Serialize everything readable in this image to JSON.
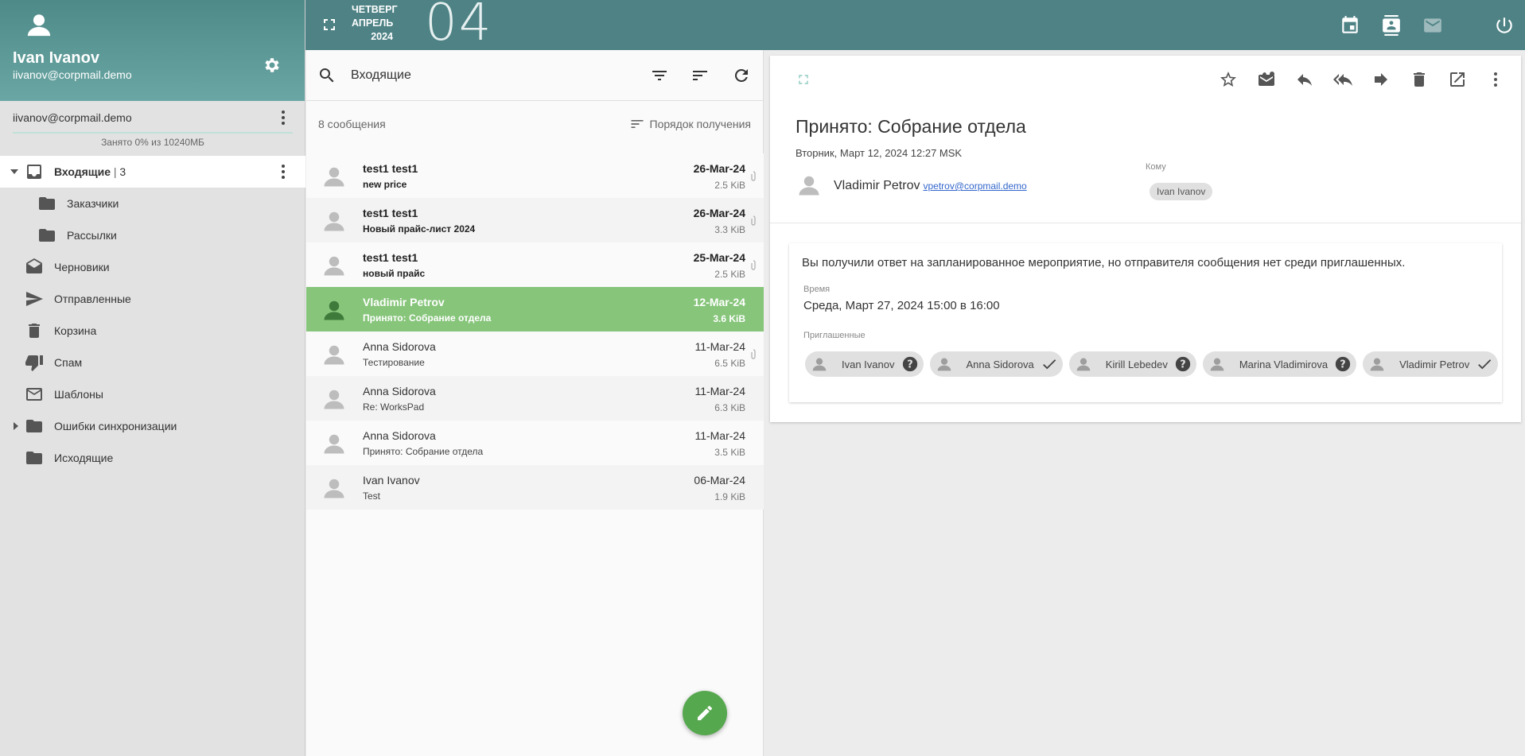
{
  "profile": {
    "name": "Ivan Ivanov",
    "email": "iivanov@corpmail.demo"
  },
  "account": {
    "address": "iivanov@corpmail.demo",
    "quota_text": "Занято 0% из 10240МБ",
    "quota_percent": 0
  },
  "folders": [
    {
      "label": "Входящие",
      "count": "3",
      "icon": "inbox-icon"
    },
    {
      "label": "Заказчики",
      "icon": "folder-icon"
    },
    {
      "label": "Рассылки",
      "icon": "folder-icon"
    },
    {
      "label": "Черновики",
      "icon": "drafts-icon"
    },
    {
      "label": "Отправленные",
      "icon": "send-icon"
    },
    {
      "label": "Корзина",
      "icon": "trash-icon"
    },
    {
      "label": "Спам",
      "icon": "thumb-down-icon"
    },
    {
      "label": "Шаблоны",
      "icon": "envelope-icon"
    },
    {
      "label": "Ошибки синхронизации",
      "icon": "folder-icon"
    },
    {
      "label": "Исходящие",
      "icon": "folder-icon"
    }
  ],
  "header": {
    "weekday": "ЧЕТВЕРГ",
    "month": "АПРЕЛЬ",
    "year": "2024",
    "day": "04"
  },
  "search": {
    "value": "Входящие"
  },
  "list": {
    "count_label": "8 сообщения",
    "sort_label": "Порядок получения"
  },
  "messages": [
    {
      "sender": "test1 test1",
      "subject": "new price",
      "date": "26-Mar-24",
      "size": "2.5 KiB",
      "attachment": true,
      "unread": true
    },
    {
      "sender": "test1 test1",
      "subject": "Новый прайс-лист 2024",
      "date": "26-Mar-24",
      "size": "3.3 KiB",
      "attachment": true,
      "unread": true
    },
    {
      "sender": "test1 test1",
      "subject": "новый прайс",
      "date": "25-Mar-24",
      "size": "2.5 KiB",
      "attachment": true,
      "unread": true
    },
    {
      "sender": "Vladimir Petrov",
      "subject": "Принято: Собрание отдела",
      "date": "12-Mar-24",
      "size": "3.6 KiB",
      "attachment": false,
      "unread": false,
      "selected": true
    },
    {
      "sender": "Anna Sidorova",
      "subject": "Тестирование",
      "date": "11-Mar-24",
      "size": "6.5 KiB",
      "attachment": true,
      "unread": false
    },
    {
      "sender": "Anna Sidorova",
      "subject": "Re: WorksPad",
      "date": "11-Mar-24",
      "size": "6.3 KiB",
      "attachment": false,
      "unread": false
    },
    {
      "sender": "Anna Sidorova",
      "subject": "Принято: Собрание отдела",
      "date": "11-Mar-24",
      "size": "3.5 KiB",
      "attachment": false,
      "unread": false
    },
    {
      "sender": "Ivan Ivanov",
      "subject": "Test",
      "date": "06-Mar-24",
      "size": "1.9 KiB",
      "attachment": false,
      "unread": false
    }
  ],
  "reader": {
    "subject": "Принято: Собрание отдела",
    "date": "Вторник, Март 12, 2024 12:27 MSK",
    "from_name": "Vladimir Petrov",
    "from_email": "vpetrov@corpmail.demo",
    "to_label": "Кому",
    "to": "Ivan Ivanov",
    "notice": "Вы получили ответ на запланированное мероприятие, но отправителя сообщения нет среди приглашенных.",
    "time_label": "Время",
    "time": "Среда, Март 27, 2024 15:00 в 16:00",
    "invitees_label": "Приглашенные",
    "invitees": [
      {
        "name": "Ivan Ivanov",
        "status": "unknown"
      },
      {
        "name": "Anna Sidorova",
        "status": "accepted"
      },
      {
        "name": "Kirill Lebedev",
        "status": "unknown"
      },
      {
        "name": "Marina Vladimirova",
        "status": "unknown"
      },
      {
        "name": "Vladimir Petrov",
        "status": "accepted"
      }
    ]
  },
  "colors": {
    "header": "#4e8285",
    "profile": "#5f9a98",
    "selected_row": "#86c57a",
    "fab": "#56a84f",
    "link": "#3366cc"
  }
}
